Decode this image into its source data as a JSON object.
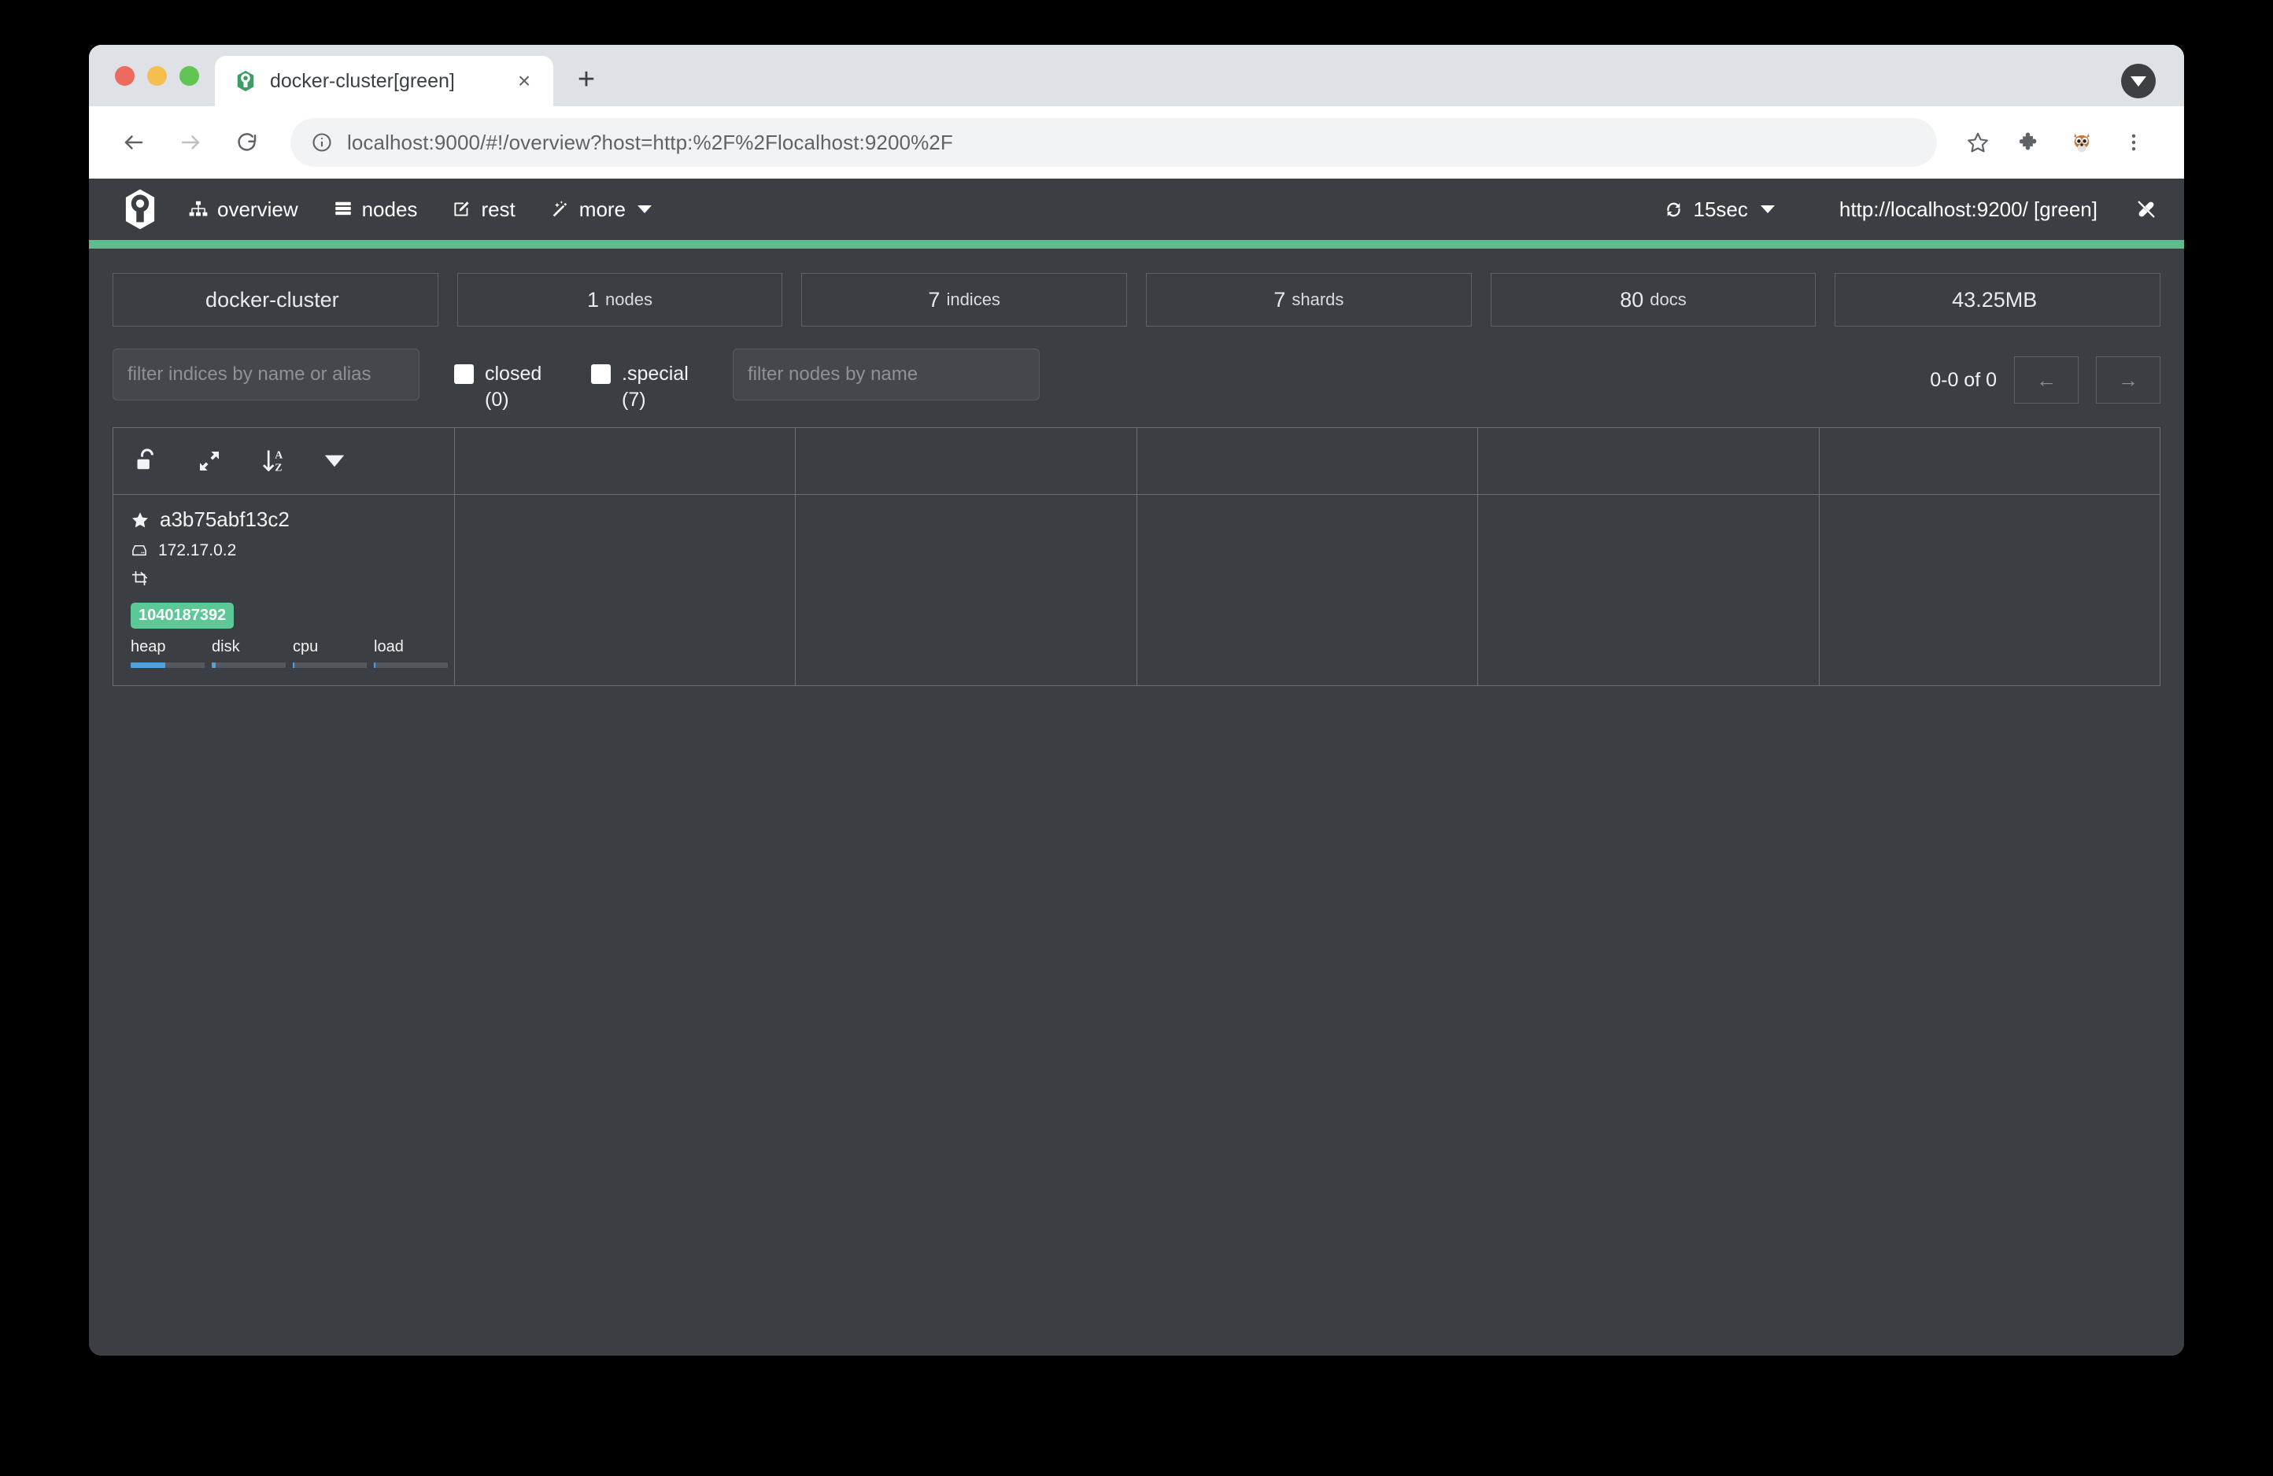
{
  "browser": {
    "tab": {
      "title": "docker-cluster[green]",
      "favicon_name": "cerebro-favicon",
      "close_label": "×"
    },
    "new_tab_label": "+",
    "toolbar": {
      "back_label": "←",
      "forward_label": "→",
      "reload_label": "↻",
      "url_secure_prefix": "localhost:9000",
      "url_rest": "/#!/overview?host=http:%2F%2Flocalhost:9200%2F",
      "url_full": "localhost:9000/#!/overview?host=http:%2F%2Flocalhost:9200%2F",
      "info_icon": "info-circle-icon",
      "bookmark_icon": "star-icon",
      "extensions_icon": "puzzle-icon",
      "profile_icon": "squirrel-avatar-icon",
      "menu_icon": "three-dot-menu-icon"
    }
  },
  "app": {
    "brand_name": "cerebro-logo",
    "nav": [
      {
        "label": "overview",
        "icon": "sitemap-icon"
      },
      {
        "label": "nodes",
        "icon": "server-list-icon"
      },
      {
        "label": "rest",
        "icon": "edit-square-icon"
      },
      {
        "label": "more",
        "icon": "magic-wand-icon",
        "has_caret": true
      }
    ],
    "refresh": {
      "icon": "refresh-icon",
      "interval": "15sec"
    },
    "host": "http://localhost:9200/ [green]",
    "disconnect_icon": "plug-disconnect-icon",
    "accent_color": "#5dbd8e"
  },
  "stats": [
    {
      "value": "docker-cluster",
      "unit": ""
    },
    {
      "value": "1",
      "unit": "nodes"
    },
    {
      "value": "7",
      "unit": "indices"
    },
    {
      "value": "7",
      "unit": "shards"
    },
    {
      "value": "80",
      "unit": "docs"
    },
    {
      "value": "43.25MB",
      "unit": ""
    }
  ],
  "filters": {
    "indices_placeholder": "filter indices by name or alias",
    "indices_value": "",
    "nodes_placeholder": "filter nodes by name",
    "nodes_value": "",
    "checkboxes": [
      {
        "label": "closed (0)",
        "checked": false
      },
      {
        "label": ".special (7)",
        "checked": false
      }
    ],
    "pager": {
      "range_text": "0-0 of 0",
      "prev_label": "←",
      "next_label": "→"
    }
  },
  "node_table": {
    "tools": [
      {
        "icon": "unlock-icon",
        "name": "toggle-lock"
      },
      {
        "icon": "expand-arrows-icon",
        "name": "expand"
      },
      {
        "icon": "sort-alpha-down-icon",
        "name": "sort"
      },
      {
        "icon": "caret-down-icon",
        "name": "sort-menu"
      }
    ],
    "column_count": 6,
    "rows": [
      {
        "master_icon": "star-icon",
        "name": "a3b75abf13c2",
        "host_icon": "server-icon",
        "ip": "172.17.0.2",
        "role_icon": "data-node-icon",
        "badge": "1040187392",
        "metrics": [
          {
            "label": "heap",
            "percent": 47
          },
          {
            "label": "disk",
            "percent": 5
          },
          {
            "label": "cpu",
            "percent": 2
          },
          {
            "label": "load",
            "percent": 2
          }
        ]
      }
    ]
  }
}
